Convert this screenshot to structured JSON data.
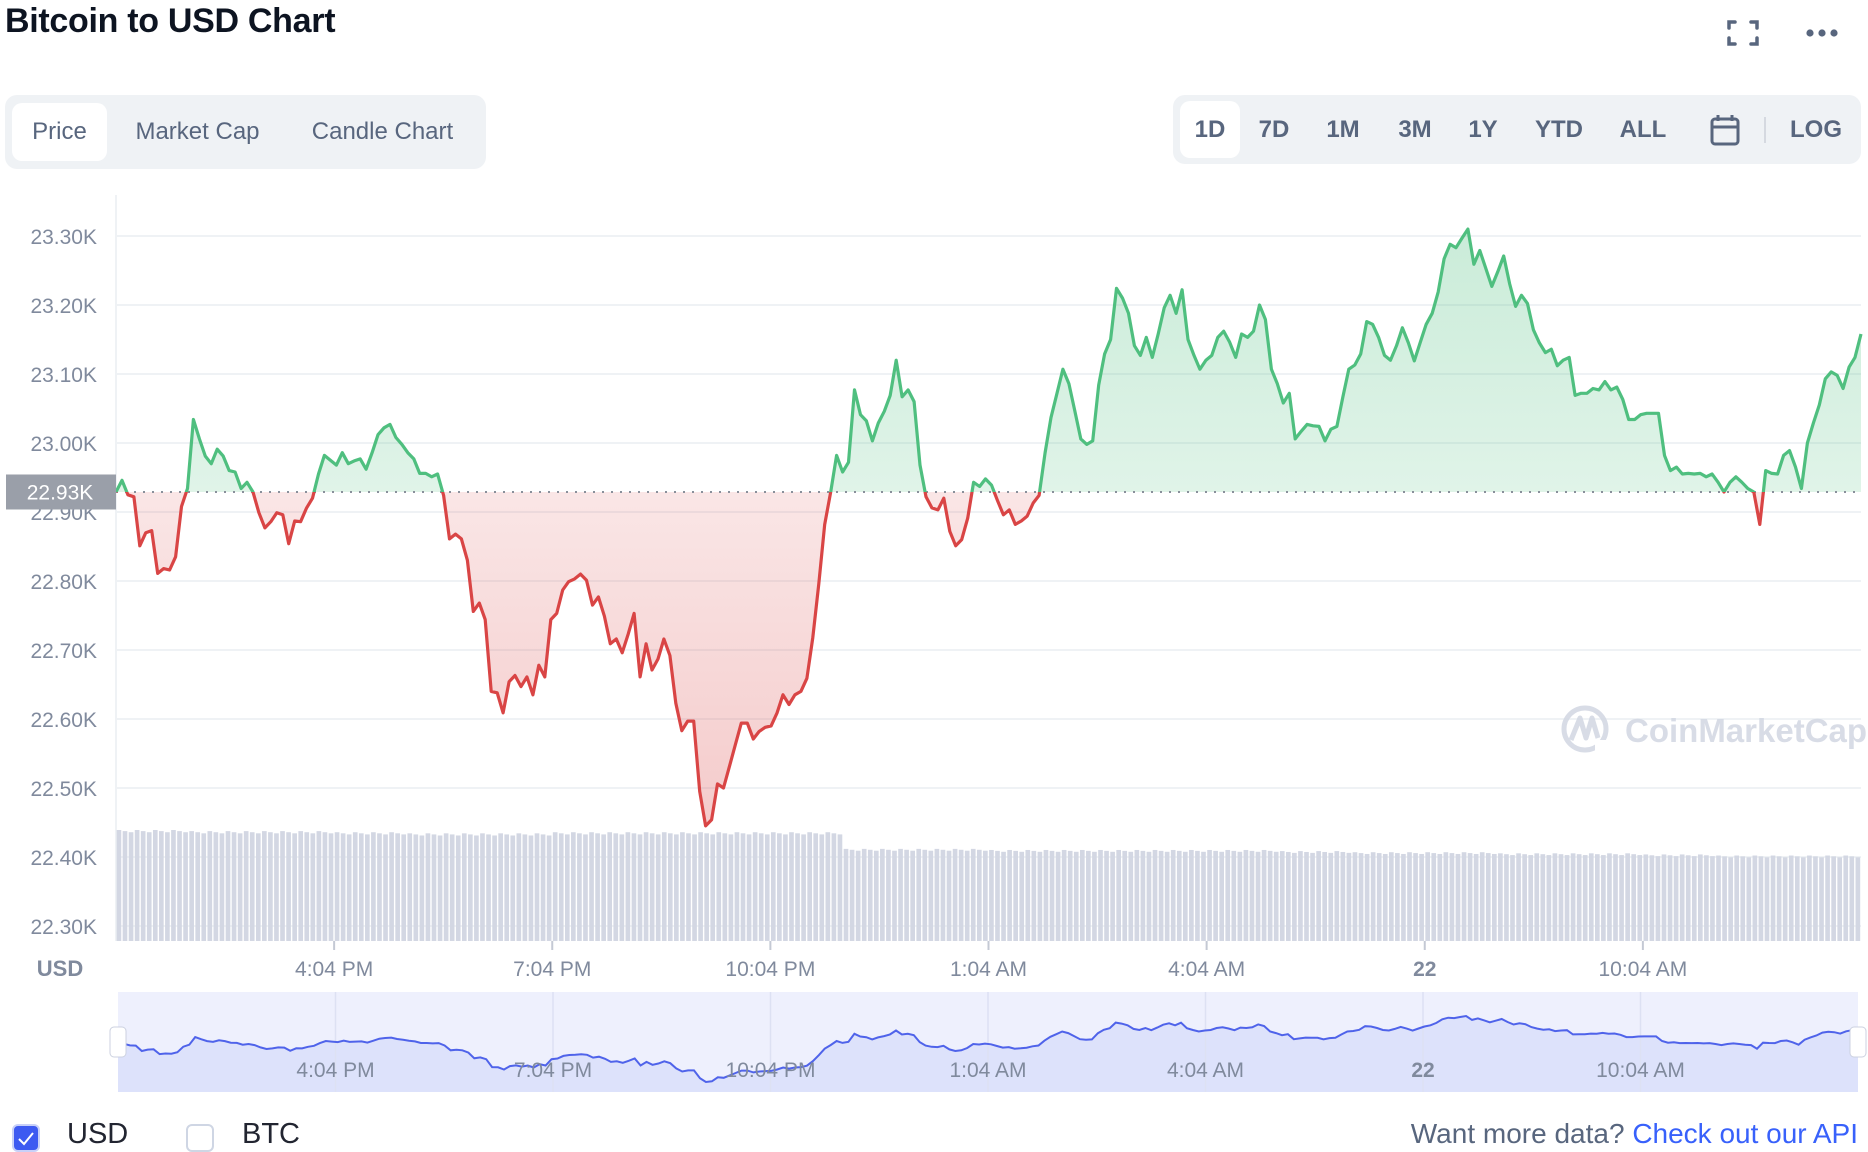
{
  "header": {
    "title": "Bitcoin to USD Chart",
    "icons": [
      "fullscreen-icon",
      "more-options-icon"
    ]
  },
  "tabs": [
    {
      "label": "Price",
      "active": true
    },
    {
      "label": "Market Cap",
      "active": false
    },
    {
      "label": "Candle Chart",
      "active": false
    }
  ],
  "ranges": [
    {
      "label": "1D",
      "active": true
    },
    {
      "label": "7D",
      "active": false
    },
    {
      "label": "1M",
      "active": false
    },
    {
      "label": "3M",
      "active": false
    },
    {
      "label": "1Y",
      "active": false
    },
    {
      "label": "YTD",
      "active": false
    },
    {
      "label": "ALL",
      "active": false
    }
  ],
  "range_calendar_icon": "calendar-icon",
  "log_label": "LOG",
  "watermark": "CoinMarketCap",
  "colors": {
    "up": "#4fbf7f",
    "down": "#d94545",
    "navigator_line": "#4f63ea",
    "badge": "#9a9fa9"
  },
  "chart_data": {
    "type": "area",
    "currency_label": "USD",
    "baseline_label": "22.93K",
    "baseline_value": 22929,
    "ylim": [
      22278,
      23359
    ],
    "y_ticks": [
      {
        "value": 23300,
        "label": "23.30K"
      },
      {
        "value": 23200,
        "label": "23.20K"
      },
      {
        "value": 23100,
        "label": "23.10K"
      },
      {
        "value": 23000,
        "label": "23.00K"
      },
      {
        "value": 22900,
        "label": "22.90K"
      },
      {
        "value": 22800,
        "label": "22.80K"
      },
      {
        "value": 22700,
        "label": "22.70K"
      },
      {
        "value": 22600,
        "label": "22.60K"
      },
      {
        "value": 22500,
        "label": "22.50K"
      },
      {
        "value": 22400,
        "label": "22.40K"
      },
      {
        "value": 22300,
        "label": "22.30K"
      }
    ],
    "x_ticks": [
      {
        "label": "4:04 PM",
        "bold": false
      },
      {
        "label": "7:04 PM",
        "bold": false
      },
      {
        "label": "10:04 PM",
        "bold": false
      },
      {
        "label": "1:04 AM",
        "bold": false
      },
      {
        "label": "4:04 AM",
        "bold": false
      },
      {
        "label": "22",
        "bold": true
      },
      {
        "label": "10:04 AM",
        "bold": false
      }
    ],
    "price": [
      22929,
      22946,
      22925,
      22922,
      22851,
      22870,
      22873,
      22811,
      22818,
      22816,
      22835,
      22908,
      22934,
      23034,
      23006,
      22981,
      22970,
      22991,
      22981,
      22960,
      22958,
      22934,
      22943,
      22929,
      22899,
      22877,
      22886,
      22899,
      22896,
      22854,
      22887,
      22886,
      22906,
      22920,
      22955,
      22982,
      22975,
      22968,
      22986,
      22970,
      22974,
      22977,
      22962,
      22986,
      23012,
      23022,
      23027,
      23008,
      22998,
      22986,
      22977,
      22956,
      22956,
      22951,
      22955,
      22924,
      22861,
      22868,
      22861,
      22830,
      22756,
      22768,
      22744,
      22640,
      22638,
      22609,
      22654,
      22663,
      22647,
      22661,
      22635,
      22678,
      22661,
      22744,
      22753,
      22787,
      22799,
      22803,
      22810,
      22801,
      22765,
      22777,
      22749,
      22709,
      22716,
      22696,
      22723,
      22753,
      22661,
      22709,
      22671,
      22687,
      22716,
      22692,
      22623,
      22583,
      22597,
      22597,
      22495,
      22445,
      22454,
      22506,
      22500,
      22531,
      22563,
      22594,
      22594,
      22571,
      22582,
      22588,
      22590,
      22609,
      22635,
      22621,
      22635,
      22640,
      22659,
      22718,
      22796,
      22882,
      22929,
      22982,
      22958,
      22972,
      23077,
      23041,
      23032,
      23003,
      23029,
      23046,
      23069,
      23120,
      23067,
      23077,
      23060,
      22968,
      22922,
      22906,
      22903,
      22920,
      22872,
      22851,
      22860,
      22891,
      22943,
      22937,
      22948,
      22939,
      22917,
      22896,
      22903,
      22882,
      22887,
      22894,
      22913,
      22924,
      22986,
      23037,
      23072,
      23107,
      23086,
      23046,
      23006,
      22998,
      23003,
      23084,
      23129,
      23150,
      23224,
      23210,
      23188,
      23141,
      23127,
      23153,
      23124,
      23158,
      23196,
      23214,
      23188,
      23222,
      23150,
      23127,
      23107,
      23120,
      23127,
      23153,
      23162,
      23146,
      23124,
      23158,
      23153,
      23162,
      23200,
      23179,
      23107,
      23086,
      23058,
      23072,
      23006,
      23017,
      23027,
      23025,
      23024,
      23003,
      23020,
      23024,
      23067,
      23107,
      23113,
      23129,
      23176,
      23172,
      23153,
      23127,
      23120,
      23141,
      23167,
      23145,
      23119,
      23146,
      23172,
      23188,
      23219,
      23267,
      23288,
      23283,
      23297,
      23310,
      23259,
      23279,
      23253,
      23227,
      23248,
      23271,
      23231,
      23198,
      23214,
      23202,
      23164,
      23145,
      23131,
      23136,
      23112,
      23120,
      23124,
      23069,
      23072,
      23072,
      23079,
      23077,
      23089,
      23077,
      23081,
      23063,
      23034,
      23034,
      23041,
      23043,
      23043,
      23043,
      22982,
      22960,
      22965,
      22955,
      22956,
      22955,
      22956,
      22951,
      22955,
      22943,
      22929,
      22943,
      22951,
      22943,
      22934,
      22929,
      22882,
      22960,
      22956,
      22955,
      22982,
      22989,
      22965,
      22934,
      23000,
      23029,
      23055,
      23093,
      23103,
      23098,
      23079,
      23110,
      23124,
      23158
    ],
    "volume_relative_hourly": [
      100,
      99,
      99,
      98,
      97,
      97,
      98,
      98,
      98,
      98,
      83,
      83,
      82,
      82,
      82,
      82,
      81,
      80,
      80,
      79,
      79,
      78,
      77,
      77
    ]
  },
  "legend": [
    {
      "label": "USD",
      "checked": true
    },
    {
      "label": "BTC",
      "checked": false
    }
  ],
  "api": {
    "prefix": "Want more data?",
    "link": "Check out our API"
  }
}
